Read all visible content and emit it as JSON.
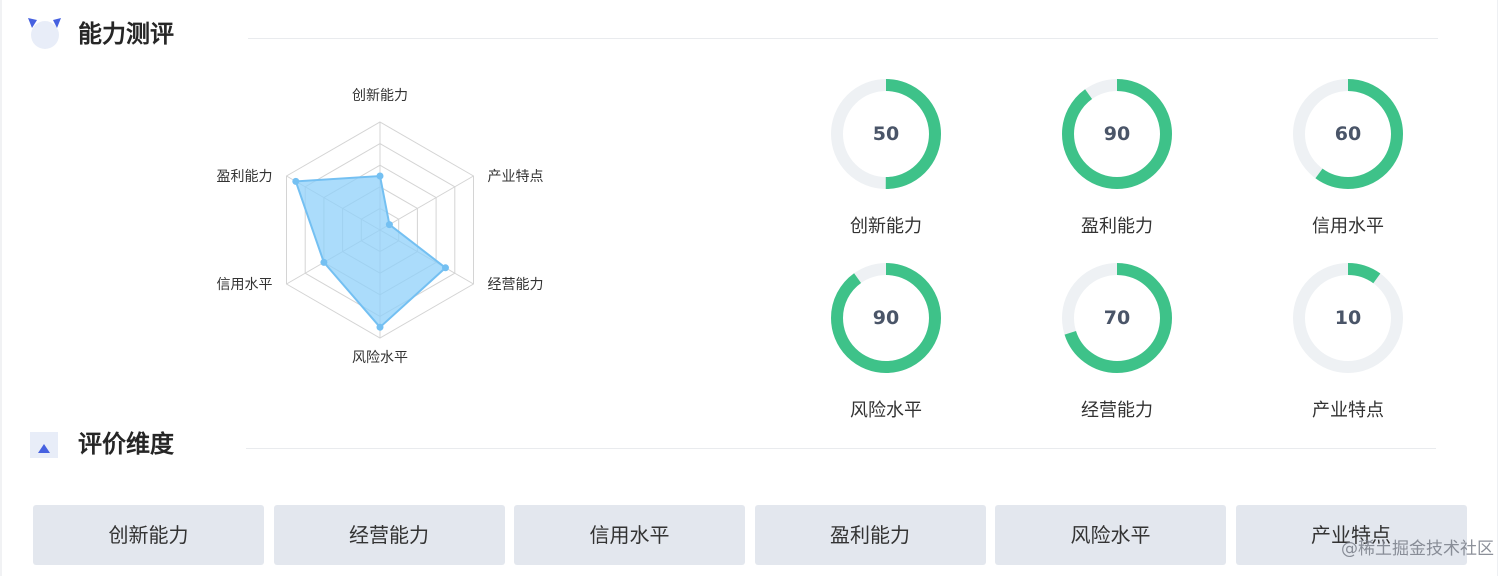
{
  "sections": {
    "assessment_title": "能力测评",
    "dimensions_title": "评价维度"
  },
  "chart_data": {
    "type": "radar",
    "axes": [
      "创新能力",
      "产业特点",
      "经营能力",
      "风险水平",
      "信用水平",
      "盈利能力"
    ],
    "series": [
      {
        "values": [
          50,
          10,
          70,
          90,
          60,
          90
        ]
      }
    ],
    "max": 100,
    "rings": 5,
    "colors": {
      "fill": "#8fd0fa",
      "stroke": "#74c0f2",
      "grid": "#d4d4d4"
    }
  },
  "gauges": [
    {
      "label": "创新能力",
      "value": "50",
      "percent": 50
    },
    {
      "label": "盈利能力",
      "value": "90",
      "percent": 90
    },
    {
      "label": "信用水平",
      "value": "60",
      "percent": 60
    },
    {
      "label": "风险水平",
      "value": "90",
      "percent": 90
    },
    {
      "label": "经营能力",
      "value": "70",
      "percent": 70
    },
    {
      "label": "产业特点",
      "value": "10",
      "percent": 10
    }
  ],
  "gauge_colors": {
    "progress": "#3ec289",
    "track": "#eef1f4"
  },
  "dimension_buttons": [
    "创新能力",
    "经营能力",
    "信用水平",
    "盈利能力",
    "风险水平",
    "产业特点"
  ],
  "watermark": "@稀土掘金技术社区"
}
